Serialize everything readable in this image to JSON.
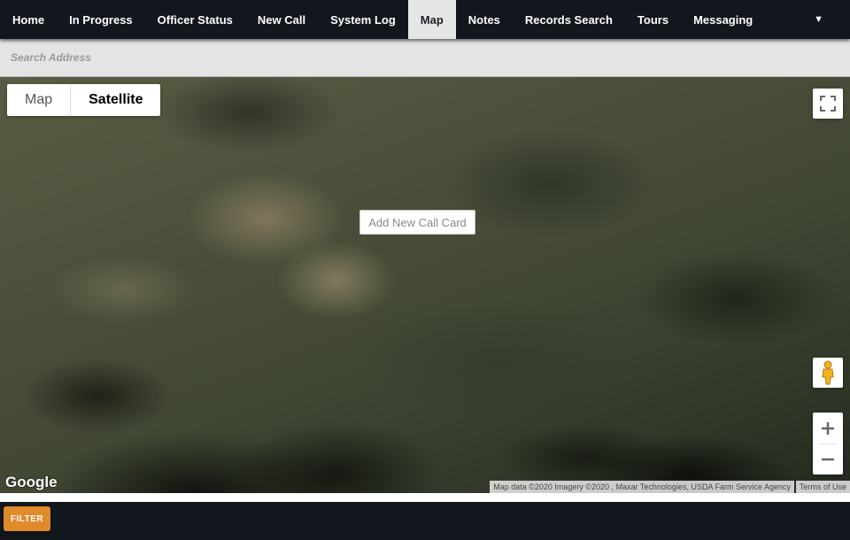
{
  "nav": {
    "items": [
      {
        "label": "Home"
      },
      {
        "label": "In Progress"
      },
      {
        "label": "Officer Status"
      },
      {
        "label": "New Call"
      },
      {
        "label": "System Log"
      },
      {
        "label": "Map",
        "active": true
      },
      {
        "label": "Notes"
      },
      {
        "label": "Records Search"
      },
      {
        "label": "Tours"
      },
      {
        "label": "Messaging"
      }
    ],
    "menu_icon": "caret-down-icon"
  },
  "search": {
    "placeholder": "Search Address",
    "value": ""
  },
  "map": {
    "type_options": {
      "map_label": "Map",
      "satellite_label": "Satellite",
      "selected": "Satellite"
    },
    "call_card_button": "Add New Call Card",
    "logo": "Google",
    "attribution": "Map data ©2020 Imagery ©2020 , Maxar Technologies, USDA Farm Service Agency",
    "terms": "Terms of Use",
    "controls": {
      "fullscreen_icon": "fullscreen-icon",
      "pegman_icon": "pegman-icon",
      "zoom_in_icon": "plus-icon",
      "zoom_out_icon": "minus-icon"
    }
  },
  "footer": {
    "filter_label": "FILTER"
  },
  "colors": {
    "nav_bg": "#12161d",
    "active_tab_bg": "#e6e6e6",
    "filter_button": "#e08a2c"
  }
}
